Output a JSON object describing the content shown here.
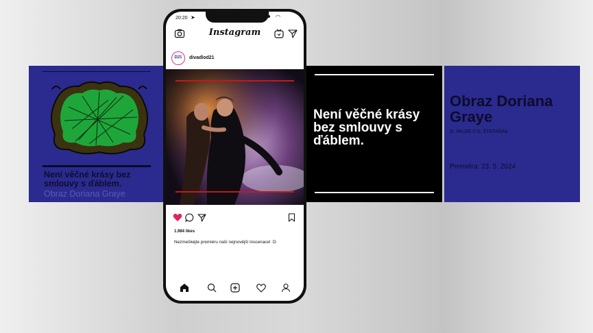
{
  "slide1": {
    "text": "Není věčné krásy bez smlouvy s ďáblem.",
    "sub": "Obraz Doriana Graye"
  },
  "slide3": {
    "text": "Není věčné krásy bez smlouvy s ďáblem."
  },
  "slide4": {
    "title": "Obraz Doriana Graye",
    "authors": "O. WILDE // O. ŠTEFAŇÁK",
    "premiere": "Premiéra: 23. 5. 2024"
  },
  "phone": {
    "status_time": "20:20",
    "app_title": "Instagram",
    "post": {
      "avatar_text": "D21",
      "username": "divadlod21",
      "likes": "1.984 likes",
      "caption": "Nezmeškejte premiéru naší nejnovější inscenace! :D"
    },
    "icons": {
      "camera": "camera-icon",
      "igtv": "igtv-icon",
      "dm": "direct-message-icon",
      "like": "heart-filled-icon",
      "comment": "comment-icon",
      "share": "share-icon",
      "save": "bookmark-icon",
      "home": "home-icon",
      "search": "search-icon",
      "add": "add-post-icon",
      "activity": "heart-outline-icon",
      "profile": "profile-icon"
    }
  },
  "colors": {
    "slide_blue": "#2b2a8f",
    "slide_black": "#000000",
    "like_red": "#e0245e",
    "accent_red": "#c21a1a"
  }
}
